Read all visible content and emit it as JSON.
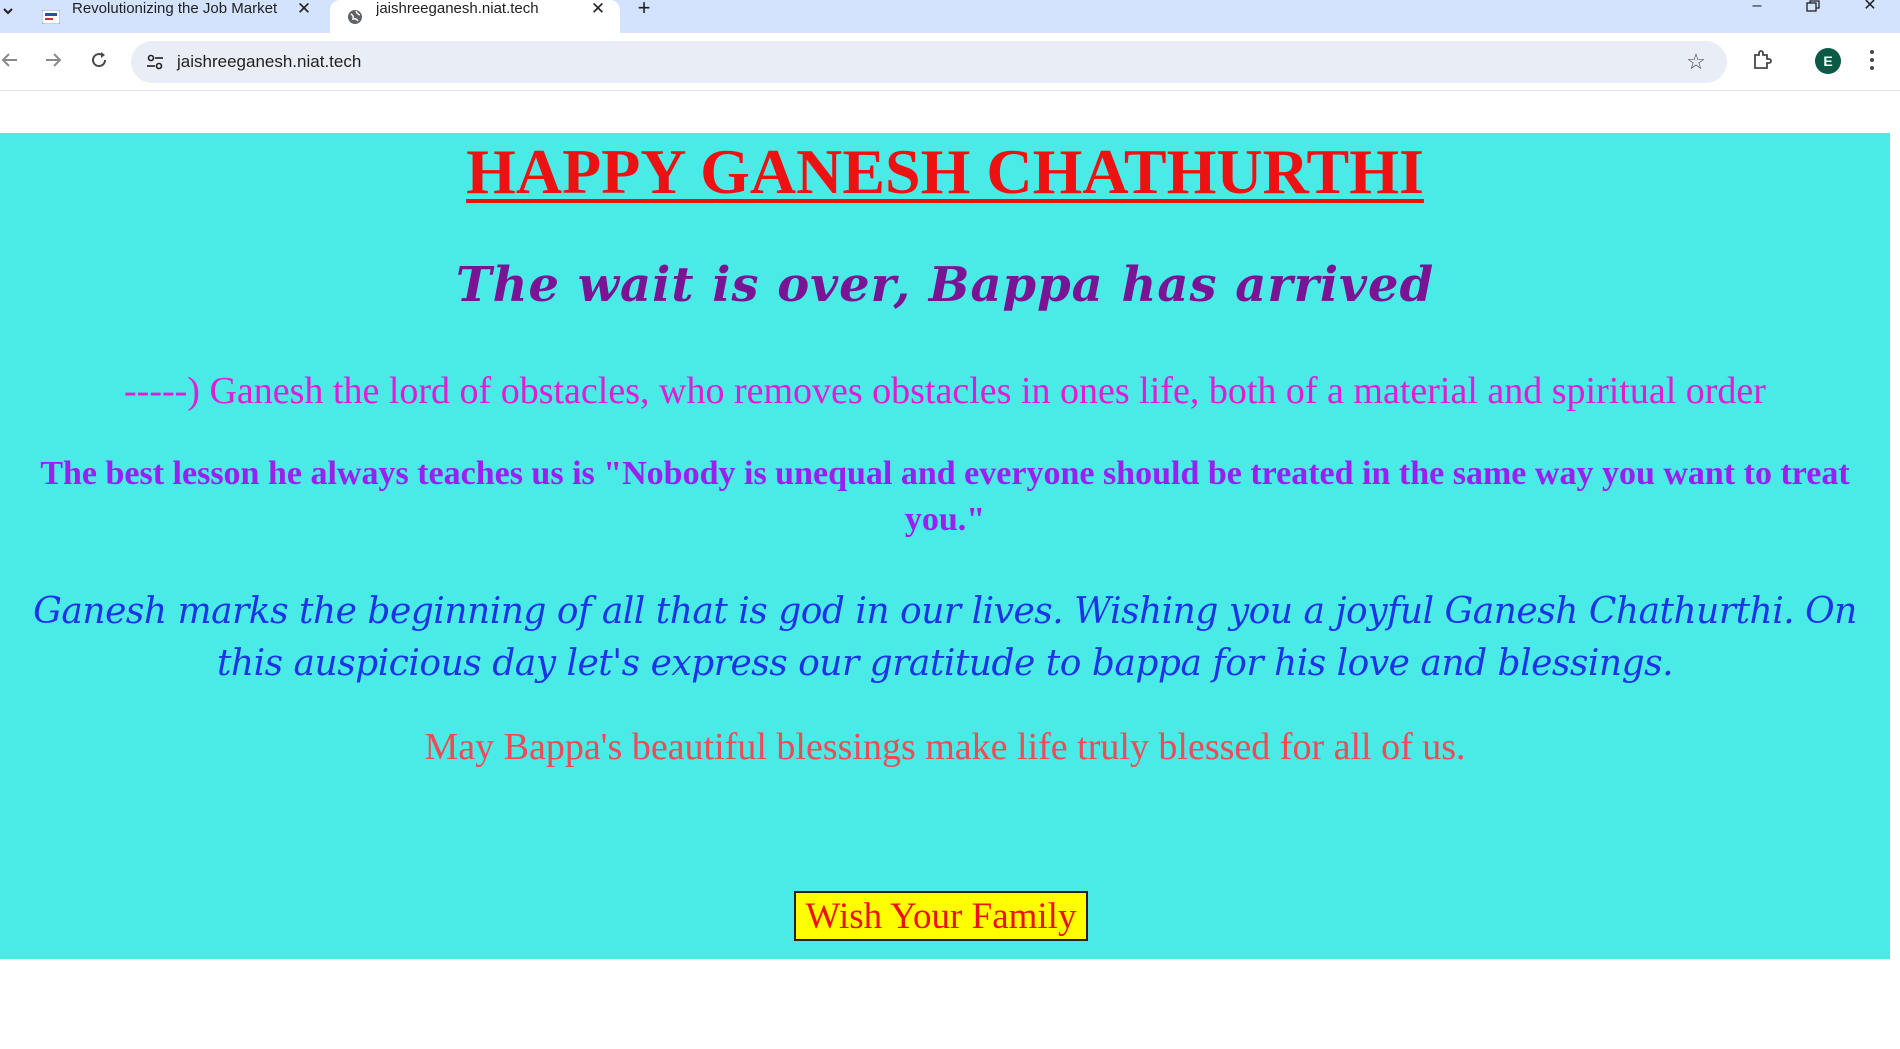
{
  "browser": {
    "tabs": [
      {
        "title": "Revolutionizing the Job Market",
        "active": false
      },
      {
        "title": "jaishreeganesh.niat.tech",
        "active": true
      }
    ],
    "address_bar": {
      "url": "jaishreeganesh.niat.tech"
    },
    "profile_initial": "E",
    "icons": {
      "tab_dropdown": "chevron-down-icon",
      "new_tab": "plus-icon",
      "back": "arrow-left-icon",
      "forward": "arrow-right-icon",
      "reload": "reload-icon",
      "site_info": "tune-icon",
      "bookmark": "star-icon",
      "extensions": "puzzle-icon",
      "menu": "kebab-menu-icon"
    },
    "window_controls": [
      "minimize",
      "restore",
      "close"
    ]
  },
  "page": {
    "background_color": "#4aeae6",
    "heading": "HAPPY GANESH CHATHURTHI",
    "subheading": "The wait is over, Bappa has arrived",
    "obstacles_line": "-----) Ganesh the lord of obstacles, who removes obstacles in ones life, both of a material and spiritual order",
    "lesson": "The best lesson he always teaches us is \"Nobody is unequal and everyone should be treated in the same way you want to treat you.\"",
    "wishes": "Ganesh marks the beginning of all that is god in our lives. Wishing you a joyful Ganesh Chathurthi. On this auspicious day let's express our gratitude to bappa for his love and blessings.",
    "blessing": "May Bappa's beautiful blessings make life truly blessed for all of us.",
    "button_label": "Wish Your Family",
    "colors": {
      "heading": "#ee1111",
      "subheading": "#7a1495",
      "obstacles_line": "#e21bd6",
      "lesson": "#9a1ff0",
      "wishes": "#1d34e6",
      "blessing": "#ef4a55",
      "button_background": "#ffff00",
      "button_text": "#ee1111"
    }
  }
}
